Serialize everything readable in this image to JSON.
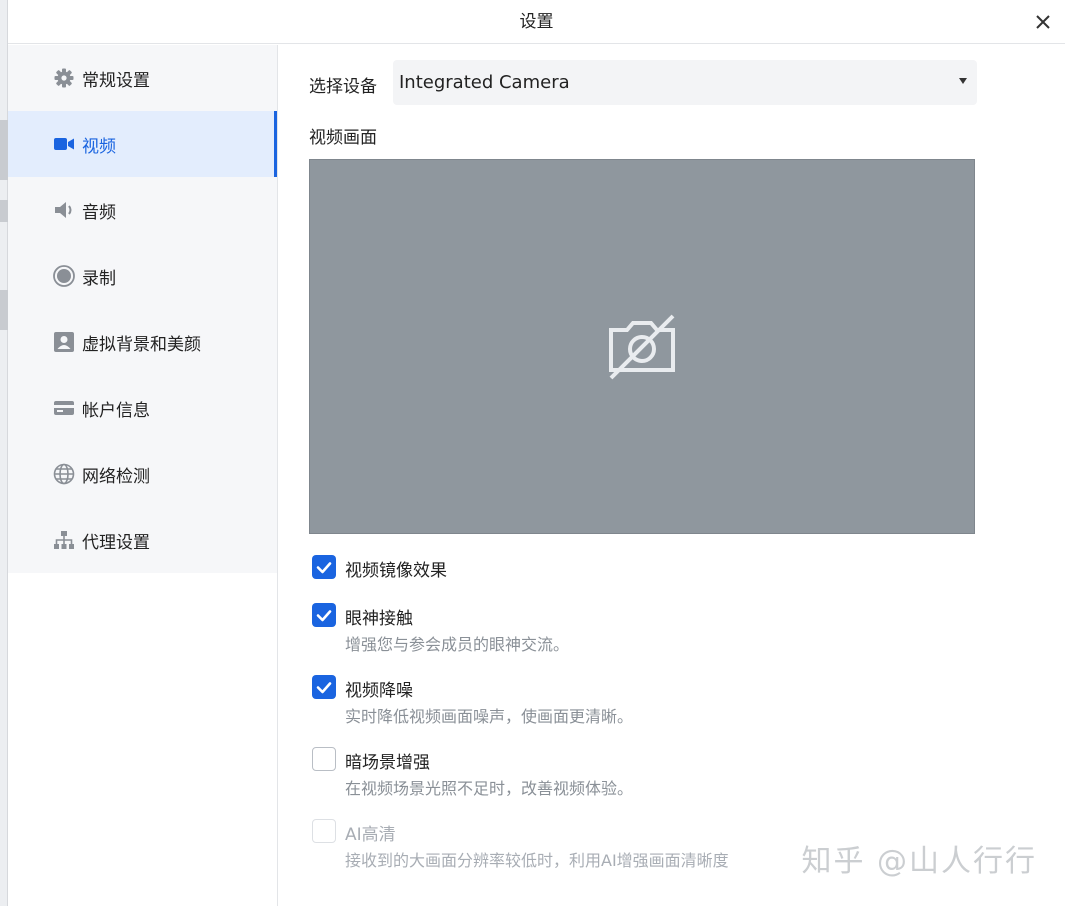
{
  "window": {
    "title": "设置"
  },
  "sidebar": {
    "items": [
      {
        "label": "常规设置",
        "icon": "gear-icon"
      },
      {
        "label": "视频",
        "icon": "video-camera-icon",
        "active": true
      },
      {
        "label": "音频",
        "icon": "speaker-icon"
      },
      {
        "label": "录制",
        "icon": "record-icon"
      },
      {
        "label": "虚拟背景和美颜",
        "icon": "portrait-icon"
      },
      {
        "label": "帐户信息",
        "icon": "card-icon"
      },
      {
        "label": "网络检测",
        "icon": "globe-icon"
      },
      {
        "label": "代理设置",
        "icon": "network-tree-icon"
      }
    ]
  },
  "video": {
    "device_label": "选择设备",
    "device_value": "Integrated Camera",
    "preview_label": "视频画面",
    "preview_icon": "camera-off-icon",
    "options": [
      {
        "label": "视频镜像效果",
        "desc": "",
        "checked": true,
        "disabled": false
      },
      {
        "label": "眼神接触",
        "desc": "增强您与参会成员的眼神交流。",
        "checked": true,
        "disabled": false
      },
      {
        "label": "视频降噪",
        "desc": "实时降低视频画面噪声，使画面更清晰。",
        "checked": true,
        "disabled": false
      },
      {
        "label": "暗场景增强",
        "desc": "在视频场景光照不足时，改善视频体验。",
        "checked": false,
        "disabled": false
      },
      {
        "label": "AI高清",
        "desc": "接收到的大画面分辨率较低时，利用AI增强画面清晰度",
        "checked": false,
        "disabled": true
      }
    ]
  },
  "watermark": "知乎 @山人行行",
  "colors": {
    "accent": "#1a64e0",
    "active_bg": "#e3edfd",
    "preview_bg": "#8f979e"
  }
}
